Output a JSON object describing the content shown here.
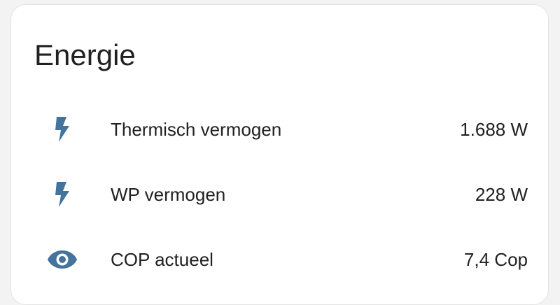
{
  "card": {
    "title": "Energie"
  },
  "entities": [
    {
      "icon": "flash-icon",
      "label": "Thermisch vermogen",
      "value": "1.688 W"
    },
    {
      "icon": "flash-icon",
      "label": "WP vermogen",
      "value": "228 W"
    },
    {
      "icon": "eye-icon",
      "label": "COP actueel",
      "value": "7,4 Cop"
    }
  ],
  "colors": {
    "icon": "#44739e",
    "text": "#212121",
    "card_background": "#ffffff",
    "page_background": "#f3f3f3"
  }
}
